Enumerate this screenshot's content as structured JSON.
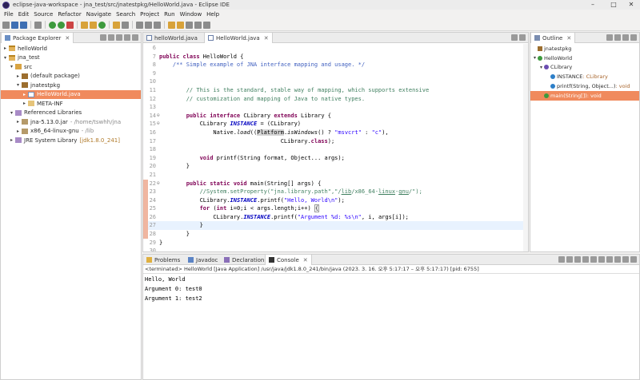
{
  "window": {
    "title": "eclipse-java-workspace - jna_test/src/jnatestpkg/HelloWorld.java - Eclipse IDE",
    "minimize": "–",
    "maximize": "□",
    "close": "✕"
  },
  "menu": [
    "File",
    "Edit",
    "Source",
    "Refactor",
    "Navigate",
    "Search",
    "Project",
    "Run",
    "Window",
    "Help"
  ],
  "package_explorer": {
    "title": "Package Explorer",
    "items": [
      {
        "label": "helloWorld",
        "level": 0,
        "twist": "▸",
        "icon": "project-icon",
        "detail": ""
      },
      {
        "label": "jna_test",
        "level": 0,
        "twist": "▾",
        "icon": "project-icon",
        "detail": ""
      },
      {
        "label": "src",
        "level": 1,
        "twist": "▾",
        "icon": "source-folder-icon",
        "detail": ""
      },
      {
        "label": "(default package)",
        "level": 2,
        "twist": "▸",
        "icon": "package-icon",
        "detail": ""
      },
      {
        "label": "jnatestpkg",
        "level": 2,
        "twist": "▾",
        "icon": "package-icon",
        "detail": ""
      },
      {
        "label": "HelloWorld.java",
        "level": 3,
        "twist": "▸",
        "icon": "java-file-icon",
        "detail": "",
        "selected": true
      },
      {
        "label": "META-INF",
        "level": 3,
        "twist": "▸",
        "icon": "folder-icon",
        "detail": ""
      },
      {
        "label": "Referenced Libraries",
        "level": 1,
        "twist": "▾",
        "icon": "library-icon",
        "detail": ""
      },
      {
        "label": "jna-5.13.0.jar",
        "level": 2,
        "twist": "▸",
        "icon": "jar-icon",
        "detail": "- /home/tswhh/jna"
      },
      {
        "label": "x86_64-linux-gnu",
        "level": 2,
        "twist": "▸",
        "icon": "jar-icon",
        "detail": "- /lib"
      },
      {
        "label": "JRE System Library",
        "level": 1,
        "twist": "▸",
        "icon": "library-icon",
        "detail": "[jdk1.8.0_241]",
        "jre": true
      }
    ]
  },
  "editor": {
    "tabs": [
      {
        "label": "helloWorld.java",
        "active": false
      },
      {
        "label": "HelloWorld.java",
        "active": true
      }
    ],
    "lines": [
      {
        "n": "6",
        "html": ""
      },
      {
        "n": "7",
        "html": "<span class='kw'>public class</span> HelloWorld {"
      },
      {
        "n": "8",
        "html": "    <span class='jd'>/** Simple example of JNA interface mapping and usage. */</span>"
      },
      {
        "n": "9",
        "html": ""
      },
      {
        "n": "10",
        "html": ""
      },
      {
        "n": "11",
        "html": "        <span class='cm'>// This is the standard, stable way of mapping, which supports extensive</span>"
      },
      {
        "n": "12",
        "html": "        <span class='cm'>// customization and mapping of Java to native types.</span>"
      },
      {
        "n": "13",
        "html": ""
      },
      {
        "n": "14",
        "fold": "⊖",
        "html": "        <span class='kw'>public interface</span> CLibrary <span class='kw'>extends</span> Library {"
      },
      {
        "n": "15",
        "fold": "⊖",
        "html": "            CLibrary <span class='fld'>INSTANCE</span> = (CLibrary)"
      },
      {
        "n": "16",
        "html": "                Native.<i>load</i>((<span class='hl'>Platform</span>.<i>isWindows</i>() ? <span class='str'>\"msvcrt\"</span> : <span class='str'>\"c\"</span>),"
      },
      {
        "n": "17",
        "html": "                                    CLibrary.<span class='kw'>class</span>);"
      },
      {
        "n": "18",
        "html": ""
      },
      {
        "n": "19",
        "html": "            <span class='kw'>void</span> printf(String format, Object... args);"
      },
      {
        "n": "20",
        "html": "        }"
      },
      {
        "n": "21",
        "html": ""
      },
      {
        "n": "22",
        "fold": "⊖",
        "chg": true,
        "html": "        <span class='kw'>public static void</span> main(String[] args) {"
      },
      {
        "n": "23",
        "chg": true,
        "html": "            <span class='cm'>//System.setProperty(\"jna.library.path\",\"/<u>lib</u>/x86_64-<u>linux</u>-<u>gnu</u>/\");</span>"
      },
      {
        "n": "24",
        "chg": true,
        "html": "            CLibrary.<span class='fld'>INSTANCE</span>.printf(<span class='str'>\"Hello, World\\n\"</span>);"
      },
      {
        "n": "25",
        "chg": true,
        "html": "            <span class='kw'>for</span> (<span class='kw'>int</span> i=0;i < args.length;i++) <span style='border:1px solid #999'>{</span>"
      },
      {
        "n": "26",
        "chg": true,
        "html": "                CLibrary.<span class='fld'>INSTANCE</span>.printf(<span class='str'>\"Argument %d: %s\\n\"</span>, i, args[i]);"
      },
      {
        "n": "27",
        "chg": true,
        "cur": true,
        "html": "            }"
      },
      {
        "n": "28",
        "chg": true,
        "html": "        }"
      },
      {
        "n": "29",
        "html": "}"
      },
      {
        "n": "30",
        "html": ""
      }
    ]
  },
  "outline": {
    "title": "Outline",
    "items": [
      {
        "label": "jnatestpkg",
        "type": "",
        "level": 0,
        "twist": "",
        "icon": "p"
      },
      {
        "label": "HelloWorld",
        "type": "",
        "level": 0,
        "twist": "▾",
        "icon": "g"
      },
      {
        "label": "CLibrary",
        "type": "",
        "level": 1,
        "twist": "▾",
        "icon": "i"
      },
      {
        "label": "INSTANCE",
        "type": " : CLibrary",
        "level": 2,
        "twist": "",
        "icon": "f"
      },
      {
        "label": "printf(String, Object...)",
        "type": " : void",
        "level": 2,
        "twist": "",
        "icon": "f"
      },
      {
        "label": "main(String[])",
        "type": " : void",
        "level": 1,
        "twist": "",
        "icon": "g",
        "selected": true
      }
    ]
  },
  "console": {
    "tabs": [
      {
        "label": "Problems",
        "icon": "prob",
        "active": false
      },
      {
        "label": "Javadoc",
        "icon": "doc",
        "active": false
      },
      {
        "label": "Declaration",
        "icon": "decl",
        "active": false
      },
      {
        "label": "Console",
        "icon": "cons",
        "active": true
      }
    ],
    "terminated": "<terminated> HelloWorld [Java Application] /usr/java/jdk1.8.0_241/bin/java  (2023. 3. 16. 오후 5:17:17 – 오후 5:17:17) [pid: 6755]",
    "output": [
      "Hello, World",
      "Argument 0: test0",
      "Argument 1: test2"
    ]
  }
}
